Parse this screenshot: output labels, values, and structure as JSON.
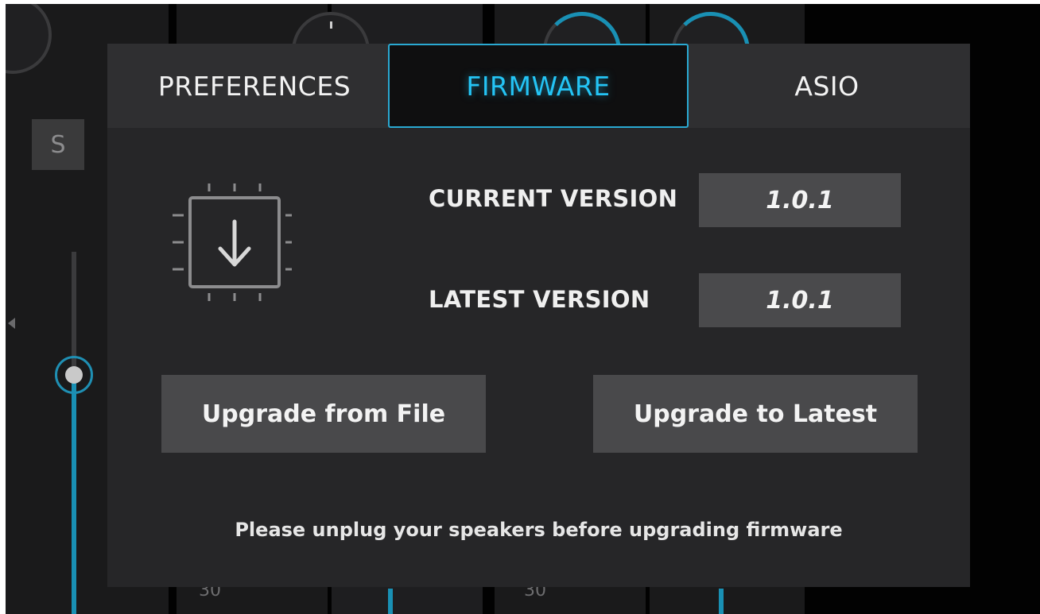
{
  "background": {
    "solo_button_label": "S",
    "bottom_numbers": [
      "30",
      "30"
    ],
    "fader_color": "#1990b4"
  },
  "dialog": {
    "tabs": [
      {
        "label": "PREFERENCES",
        "active": false
      },
      {
        "label": "FIRMWARE",
        "active": true
      },
      {
        "label": "ASIO",
        "active": false
      }
    ],
    "icon": "chip-download-icon",
    "current_version_label": "CURRENT VERSION",
    "current_version_value": "1.0.1",
    "latest_version_label": "LATEST VERSION",
    "latest_version_value": "1.0.1",
    "upgrade_file_label": "Upgrade from File",
    "upgrade_latest_label": "Upgrade to Latest",
    "note": "Please unplug your speakers before upgrading firmware",
    "accent_color": "#24c4f5"
  }
}
